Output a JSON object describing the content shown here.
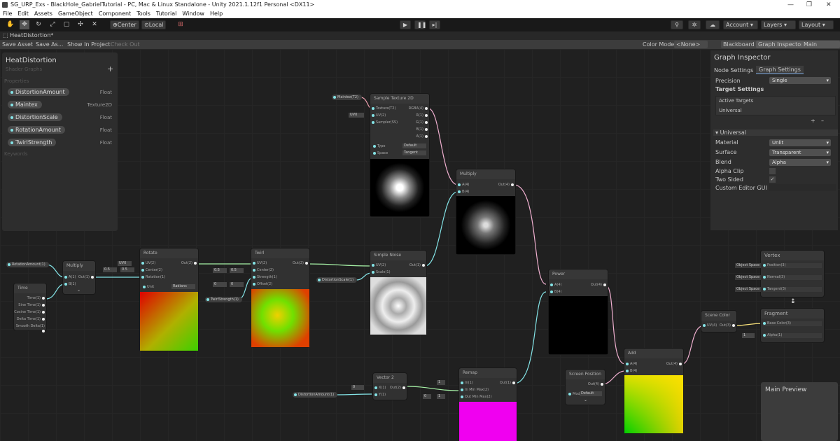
{
  "window": {
    "title": "SG_URP_Exs - BlackHole_GabrielTutorial - PC, Mac & Linux Standalone - Unity 2021.1.12f1 Personal <DX11>",
    "controls": [
      "—",
      "❐",
      "✕"
    ]
  },
  "menu": [
    "File",
    "Edit",
    "Assets",
    "GameObject",
    "Component",
    "Tools",
    "Tutorial",
    "Window",
    "Help"
  ],
  "toolbar": {
    "pivot": "Center",
    "space": "Local",
    "account": "Account",
    "layers": "Layers",
    "layout": "Layout"
  },
  "tab": {
    "label": "HeatDistortion*"
  },
  "graph_toolbar": {
    "save": "Save Asset",
    "save_as": "Save As...",
    "show": "Show In Project",
    "checkout": "Check Out",
    "color_mode": "Color Mode",
    "color_value": "<None>",
    "blackboard": "Blackboard",
    "inspector": "Graph Inspector",
    "main_preview": "Main Preview"
  },
  "blackboard": {
    "title": "HeatDistortion",
    "subtitle": "Shader Graphs",
    "properties_label": "Properties",
    "keywords_label": "Keywords",
    "properties": [
      {
        "name": "DistortionAmount",
        "type": "Float"
      },
      {
        "name": "Maintex",
        "type": "Texture2D"
      },
      {
        "name": "DistortionScale",
        "type": "Float"
      },
      {
        "name": "RotationAmount",
        "type": "Float"
      },
      {
        "name": "TwirlStrength",
        "type": "Float"
      }
    ]
  },
  "inspector": {
    "title": "Graph Inspector",
    "tab_node": "Node Settings",
    "tab_graph": "Graph Settings",
    "precision_label": "Precision",
    "precision": "Single",
    "target_settings": "Target Settings",
    "active_targets": "Active Targets",
    "target": "Universal",
    "universal": "Universal",
    "material_label": "Material",
    "material": "Unlit",
    "surface_label": "Surface",
    "surface": "Transparent",
    "blend_label": "Blend",
    "blend": "Alpha",
    "alpha_clip": "Alpha Clip",
    "two_sided": "Two Sided",
    "custom_gui": "Custom Editor GUI"
  },
  "main_preview": {
    "title": "Main Preview"
  },
  "nodes": {
    "sample": {
      "title": "Sample Texture 2D",
      "in": [
        "Texture(T2)",
        "UV(2)",
        "Sampler(SS)"
      ],
      "out": [
        "RGBA(4)",
        "R(1)",
        "G(1)",
        "B(1)",
        "A(1)"
      ],
      "type_label": "Type",
      "type": "Default",
      "space_label": "Space",
      "space": "Tangent",
      "chip": "Maintex(T2)",
      "uv": "UV0"
    },
    "multiply_top": {
      "title": "Multiply",
      "in": [
        "A(4)",
        "B(4)"
      ],
      "out": "Out(4)"
    },
    "multiply_left": {
      "title": "Multiply",
      "in": [
        "A(1)",
        "B(1)"
      ],
      "out": "Out(1)"
    },
    "time": {
      "title": "Time",
      "out": [
        "Time(1)",
        "Sine Time(1)",
        "Cosine Time(1)",
        "Delta Time(1)",
        "Smooth Delta(1)"
      ]
    },
    "rotate": {
      "title": "Rotate",
      "in": [
        "UV(2)",
        "Center(2)",
        "Rotation(1)"
      ],
      "out": "Out(2)",
      "unit_label": "Unit",
      "unit": "Radians",
      "uv": "UV0",
      "cx": "0.5",
      "cy": "0.5"
    },
    "twirl": {
      "title": "Twirl",
      "in": [
        "UV(2)",
        "Center(2)",
        "Strength(1)",
        "Offset(2)"
      ],
      "out": "Out(2)",
      "cx": "0.5",
      "cy": "0.5",
      "ox": "0",
      "oy": "0"
    },
    "noise": {
      "title": "Simple Noise",
      "in": [
        "UV(2)",
        "Scale(1)"
      ],
      "out": "Out(1)"
    },
    "power": {
      "title": "Power",
      "in": [
        "A(4)",
        "B(4)"
      ],
      "out": "Out(4)"
    },
    "remap": {
      "title": "Remap",
      "in": [
        "In(1)",
        "In Min Max(2)",
        "Out Min Max(2)"
      ],
      "out": "Out(1)",
      "in_x": "1",
      "ox": "0",
      "oy": "1"
    },
    "vector2": {
      "title": "Vector 2",
      "in": [
        "X(1)",
        "Y(1)"
      ],
      "out": "Out(2)",
      "x": "0"
    },
    "screenpos": {
      "title": "Screen Position",
      "out": "Out(4)",
      "mode_label": "Mode",
      "mode": "Default"
    },
    "add": {
      "title": "Add",
      "in": [
        "A(4)",
        "B(4)"
      ],
      "out": "Out(4)"
    },
    "scenecolor": {
      "title": "Scene Color",
      "in": "UV(4)",
      "out": "Out(3)"
    },
    "vertex": {
      "title": "Vertex",
      "ports": [
        "Position(3)",
        "Normal(3)",
        "Tangent(3)"
      ],
      "space": "Object Space"
    },
    "fragment": {
      "title": "Fragment",
      "ports": [
        "Base Color(3)",
        "Alpha(1)"
      ],
      "alpha": "1"
    }
  },
  "chips": {
    "rotation": "RotationAmount(1)",
    "twirl": "TwirlStrength(1)",
    "distscale": "DistortionScale(1)",
    "distamount": "DistortionAmount(1)"
  }
}
